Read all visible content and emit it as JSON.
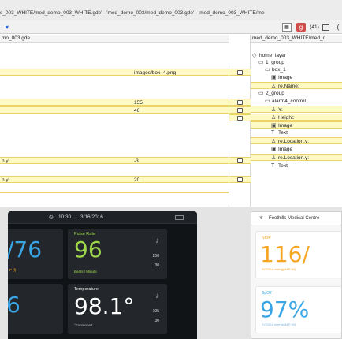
{
  "window": {
    "path": "s_003_WHITE/med_demo_003_WHITE.gde' - 'med_demo_003/med_demo_003.gde' - 'med_demo_003_WHITE/me"
  },
  "toolbar": {
    "zoom_badge": "(41)"
  },
  "columns": {
    "left_title": "mo_003.gde",
    "right_title": "med_demo_003_WHITE/med_d"
  },
  "left_rows": [
    {
      "label": "",
      "value": "images/box_4.png",
      "highlight": true
    },
    {
      "label": "",
      "value": "155",
      "highlight": true
    },
    {
      "label": "",
      "value": "46",
      "highlight": true
    },
    {
      "label": "n.y:",
      "value": "-3",
      "highlight": true
    },
    {
      "label": "n.y:",
      "value": "20",
      "highlight": true
    }
  ],
  "tree": [
    {
      "icon": "layer-icon",
      "glyph": "◇",
      "label": "home_layer",
      "indent": 0
    },
    {
      "icon": "folder-icon",
      "glyph": "▭",
      "label": "1_group",
      "indent": 1
    },
    {
      "icon": "control-icon",
      "glyph": "▭",
      "label": "box_1",
      "indent": 2
    },
    {
      "icon": "image-icon",
      "glyph": "▣",
      "label": "Image",
      "indent": 3
    },
    {
      "icon": "property-icon",
      "glyph": "♙",
      "label": "re.Name:",
      "indent": 3
    },
    {
      "icon": "folder-icon",
      "glyph": "▭",
      "label": "2_group",
      "indent": 1
    },
    {
      "icon": "control-icon",
      "glyph": "▭",
      "label": "alarm4_control",
      "indent": 2
    },
    {
      "icon": "property-icon",
      "glyph": "♙",
      "label": "Y:",
      "indent": 3
    },
    {
      "icon": "property-icon",
      "glyph": "♙",
      "label": "Height:",
      "indent": 3
    },
    {
      "icon": "image-icon",
      "glyph": "▣",
      "label": "Image",
      "indent": 3
    },
    {
      "icon": "text-icon",
      "glyph": "T",
      "label": "Text",
      "indent": 3
    },
    {
      "icon": "property-icon",
      "glyph": "♙",
      "label": "re.Location.y:",
      "indent": 3
    },
    {
      "icon": "image-icon",
      "glyph": "▣",
      "label": "Image",
      "indent": 3
    },
    {
      "icon": "property-icon",
      "glyph": "♙",
      "label": "re.Location.y:",
      "indent": 3
    },
    {
      "icon": "text-icon",
      "glyph": "T",
      "label": "Text",
      "indent": 3
    }
  ],
  "dark_monitor": {
    "time": "10:30",
    "date": "3/16/2016",
    "bp_partial": "/76",
    "bp_sub": "P (f)",
    "pulse_label": "Pulse Rate",
    "pulse_value": "96",
    "pulse_unit": "Beats / Minute",
    "pulse_hi": "250",
    "pulse_lo": "30",
    "spo2_partial": "6",
    "temp_label": "Temperature",
    "temp_value": "98.1°",
    "temp_unit": "°Fahrenheit",
    "temp_hi": "105",
    "temp_lo": "30",
    "colors": {
      "pulse": "#9ed84a",
      "bp": "#3aa6e6",
      "temp": "#ffffff"
    }
  },
  "white_monitor": {
    "title": "Foothills Medical Centre",
    "nibp_label": "NIBP",
    "nibp_value": "116/",
    "nibp_sub": "SYS/DIA mmHg(MAP 89)",
    "spo2_label": "SpO2",
    "spo2_value": "97%",
    "spo2_sub": "SYS/DIA mmHg(MAP 89)",
    "colors": {
      "nibp": "#f5a623",
      "spo2": "#3aa6e6"
    }
  }
}
